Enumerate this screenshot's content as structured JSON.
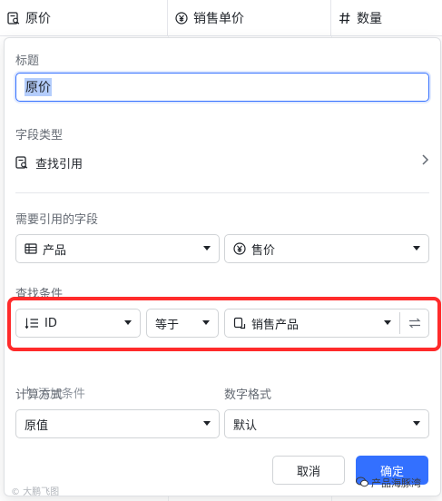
{
  "table": {
    "columns": [
      {
        "icon": "lookup-icon",
        "label": "原价"
      },
      {
        "icon": "currency-icon",
        "label": "销售单价"
      },
      {
        "icon": "number-icon",
        "label": "数量"
      }
    ]
  },
  "panel": {
    "title_label": "标题",
    "title_value": "原价",
    "type_label": "字段类型",
    "type_value": "查找引用",
    "ref_label": "需要引用的字段",
    "ref_table": "产品",
    "ref_field": "售价",
    "cond_label": "查找条件",
    "cond_field": "ID",
    "cond_op": "等于",
    "cond_value": "销售产品",
    "add_cond": "添加条件",
    "calc_label": "计算方式",
    "calc_value": "原值",
    "fmt_label": "数字格式",
    "fmt_value": "默认",
    "cancel": "取消",
    "ok": "确定"
  },
  "watermark": {
    "left": "© 大鹏飞图",
    "right": "产品海豚湾"
  },
  "colors": {
    "accent": "#3370ff",
    "highlight": "#ff2b2b"
  }
}
